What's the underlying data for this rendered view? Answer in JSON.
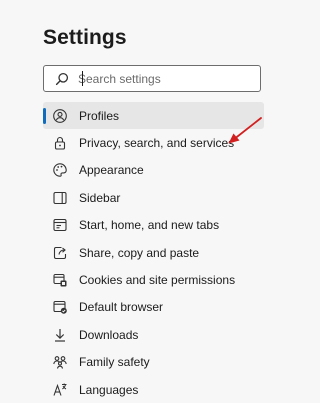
{
  "page": {
    "title": "Settings"
  },
  "search": {
    "placeholder": "Search settings",
    "icon": "search-icon"
  },
  "sidebar": {
    "active_index": 0,
    "accent_color": "#0f6cbd",
    "items": [
      {
        "label": "Profiles",
        "icon": "profile-icon"
      },
      {
        "label": "Privacy, search, and services",
        "icon": "lock-icon"
      },
      {
        "label": "Appearance",
        "icon": "palette-icon"
      },
      {
        "label": "Sidebar",
        "icon": "sidebar-icon"
      },
      {
        "label": "Start, home, and new tabs",
        "icon": "home-tabs-icon"
      },
      {
        "label": "Share, copy and paste",
        "icon": "share-icon"
      },
      {
        "label": "Cookies and site permissions",
        "icon": "cookies-icon"
      },
      {
        "label": "Default browser",
        "icon": "browser-icon"
      },
      {
        "label": "Downloads",
        "icon": "download-icon"
      },
      {
        "label": "Family safety",
        "icon": "family-icon"
      },
      {
        "label": "Languages",
        "icon": "languages-icon"
      }
    ]
  },
  "annotation": {
    "arrow_color": "#d21f1f"
  }
}
